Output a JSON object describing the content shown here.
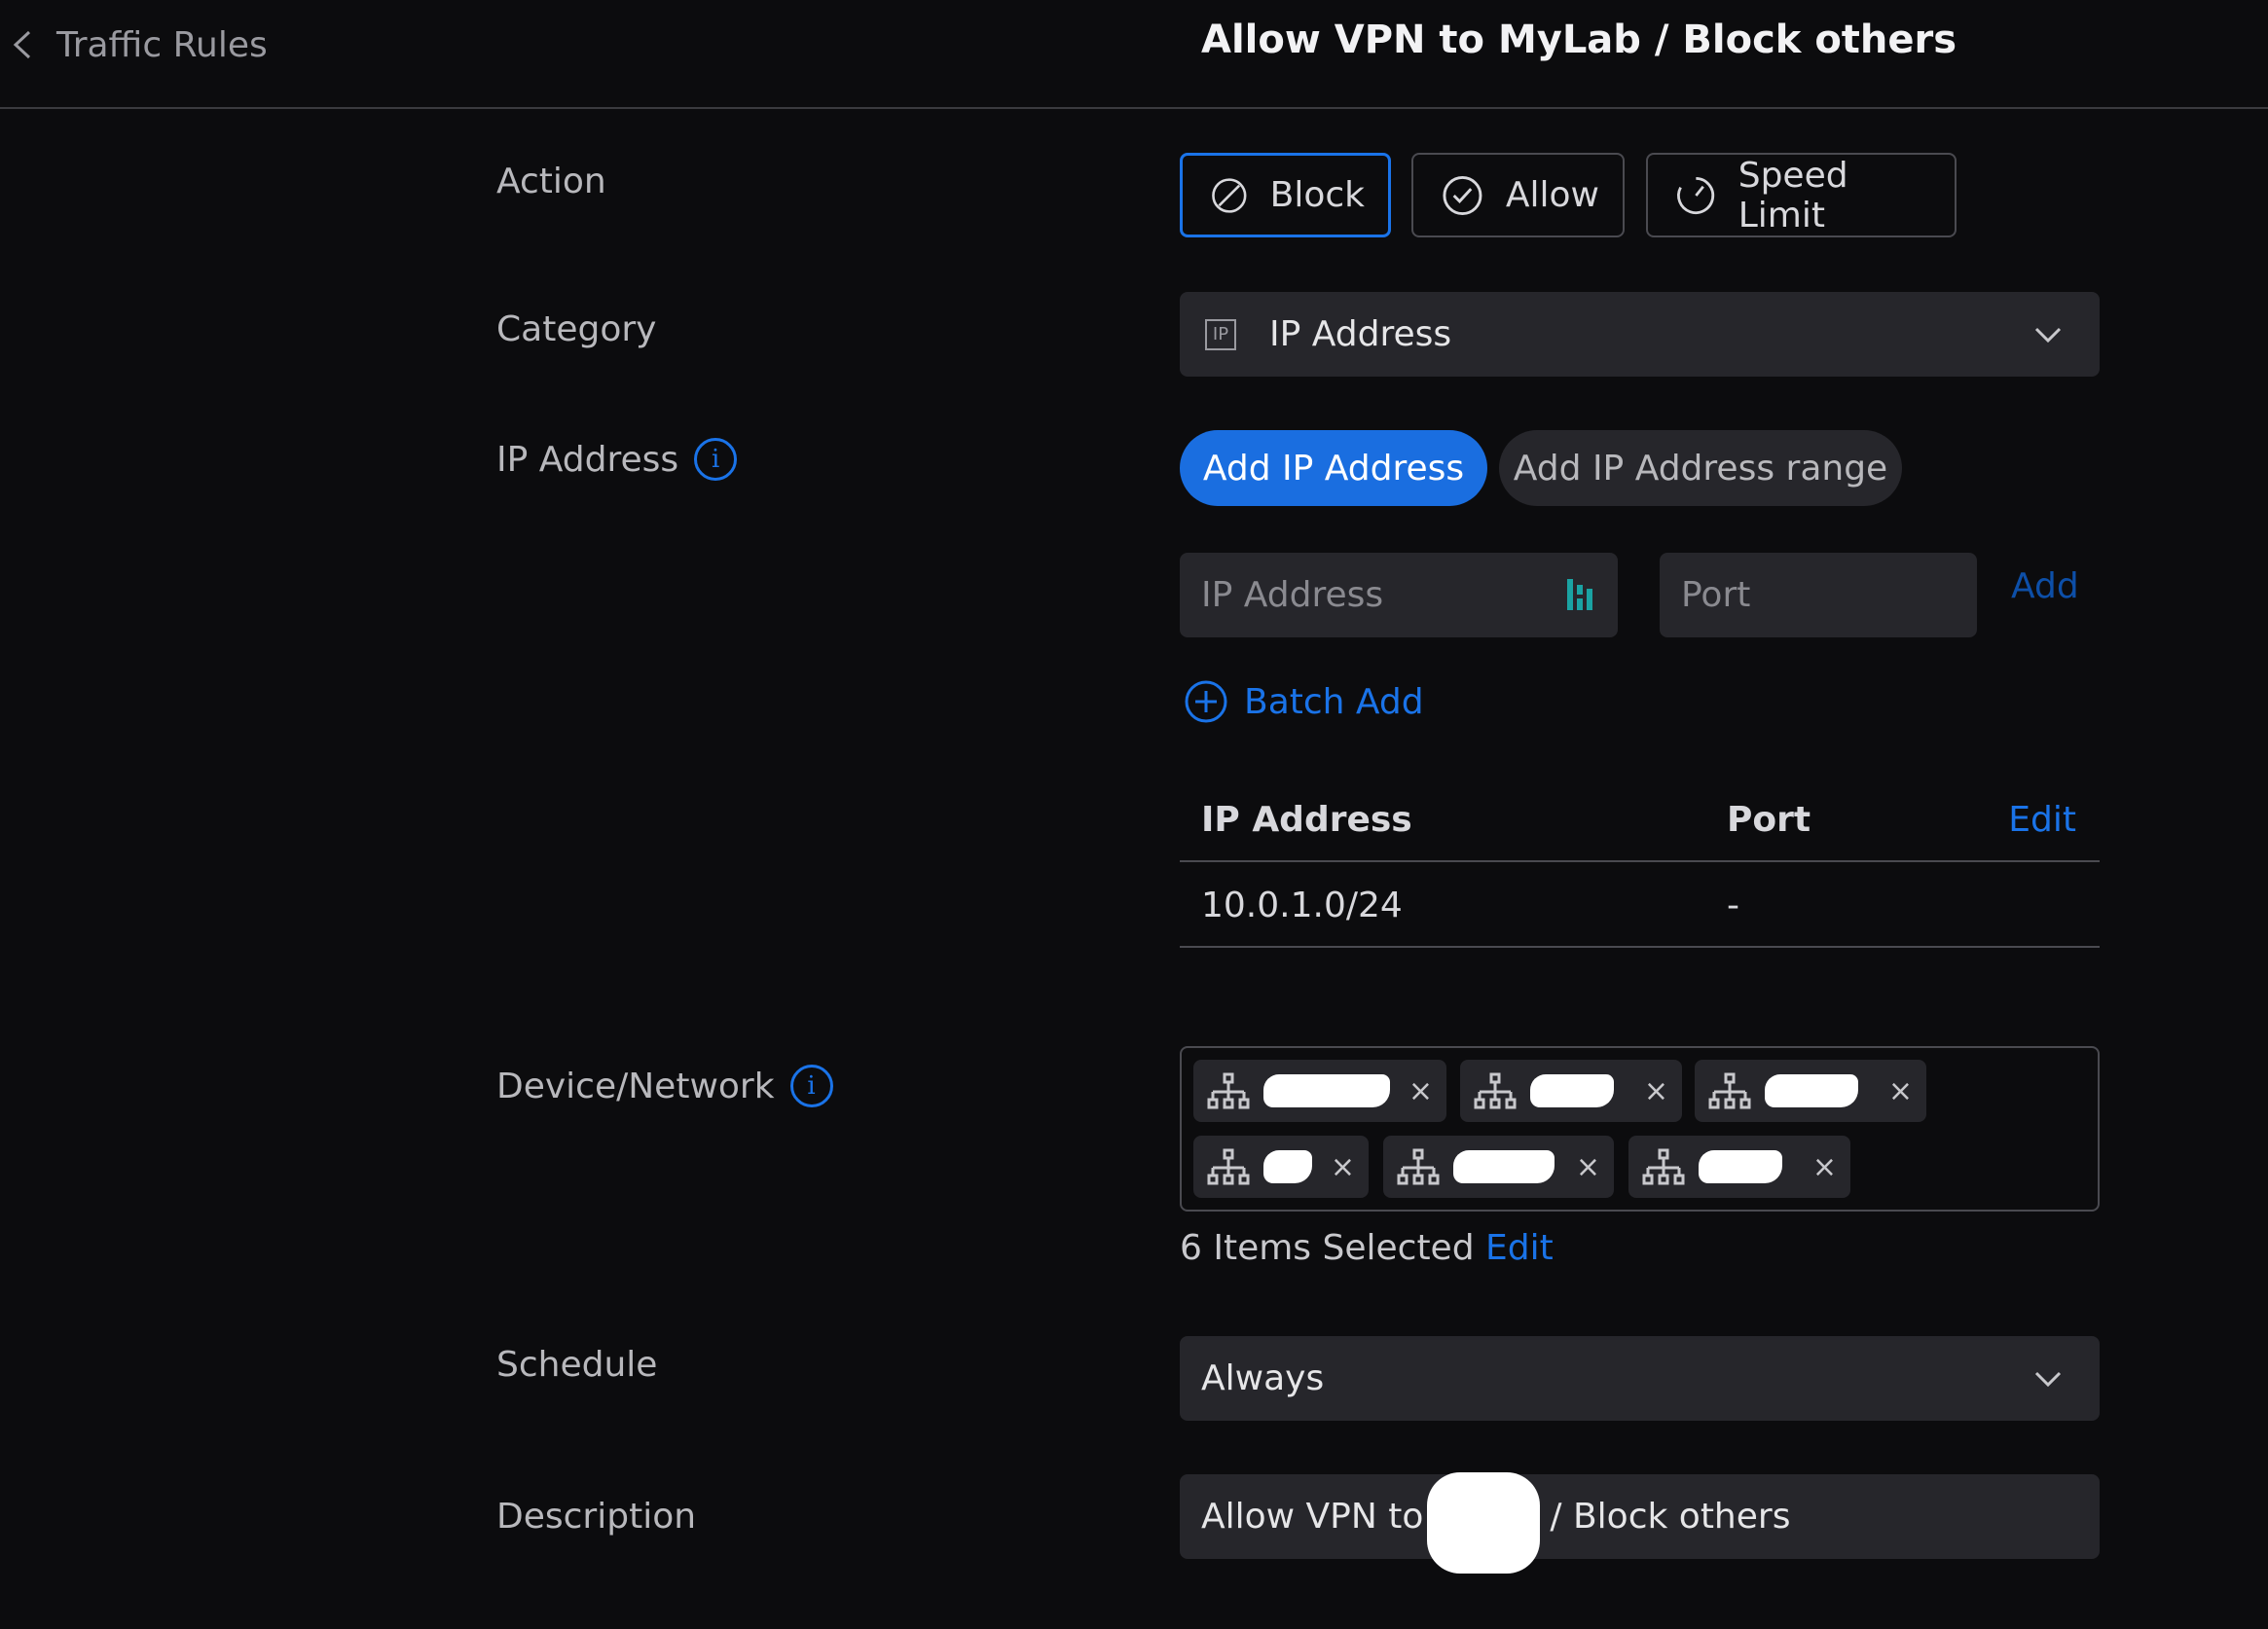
{
  "header": {
    "back_label": "Traffic Rules",
    "title": "Allow VPN to MyLab / Block others"
  },
  "action": {
    "label": "Action",
    "options": [
      "Block",
      "Allow",
      "Speed Limit"
    ],
    "selected": "Block"
  },
  "category": {
    "label": "Category",
    "icon_text": "IP",
    "value": "IP Address"
  },
  "ip_address": {
    "label": "IP Address",
    "add_ip_label": "Add IP Address",
    "add_range_label": "Add IP Address range",
    "ip_placeholder": "IP Address",
    "port_placeholder": "Port",
    "add_label": "Add",
    "batch_add_label": "Batch Add",
    "table": {
      "columns": [
        "IP Address",
        "Port"
      ],
      "edit_label": "Edit",
      "rows": [
        {
          "ip": "10.0.1.0/24",
          "port": "-"
        }
      ]
    }
  },
  "device_network": {
    "label": "Device/Network",
    "chips": [
      "",
      "",
      "",
      "",
      "",
      ""
    ],
    "remove_symbol": "×",
    "selected_summary": "6 Items Selected",
    "edit_label": "Edit"
  },
  "schedule": {
    "label": "Schedule",
    "value": "Always"
  },
  "description": {
    "label": "Description",
    "value_prefix": "Allow VPN to",
    "value_suffix": "/ Block others"
  },
  "colors": {
    "accent": "#1a73e8",
    "background": "#0c0c0e",
    "field": "#26262b"
  }
}
